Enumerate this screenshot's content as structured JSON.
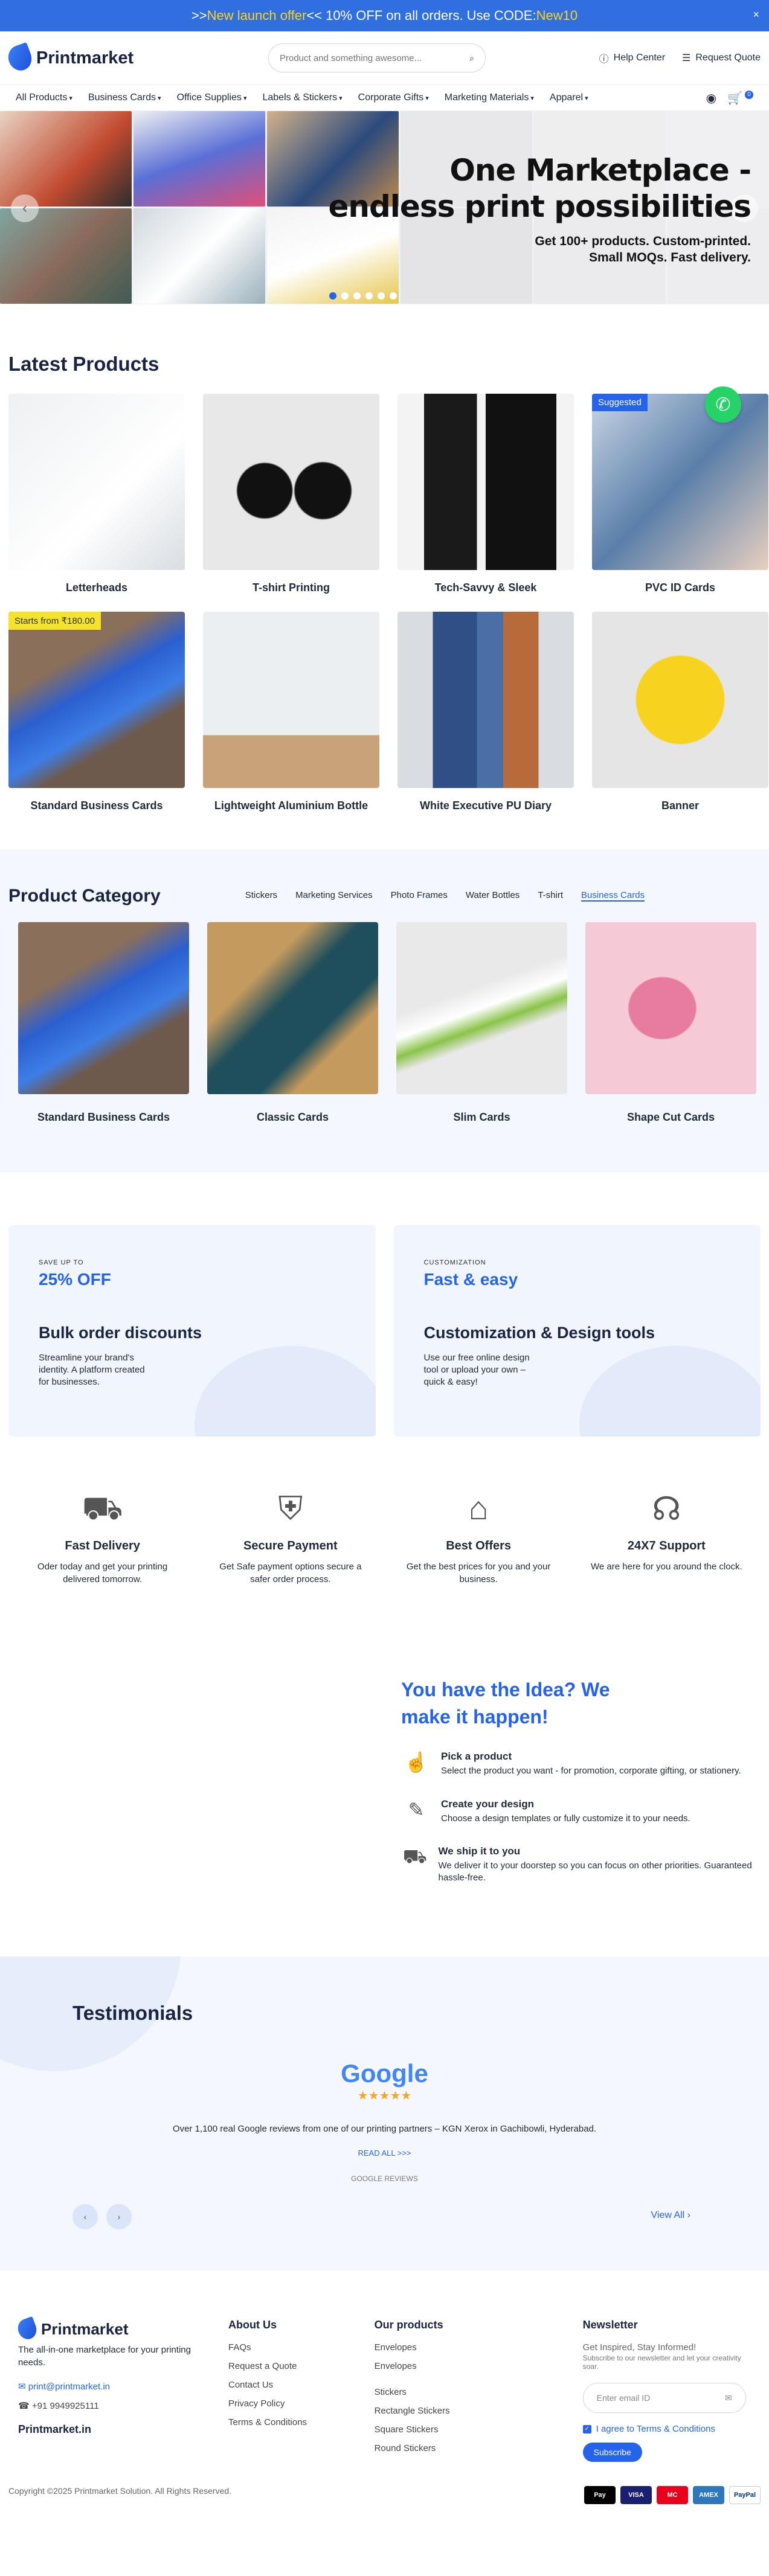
{
  "promo": {
    "pre": ">> ",
    "highlight": "New launch offer",
    "mid": " << 10% OFF on all orders. Use CODE: ",
    "code": "New10",
    "close": "×"
  },
  "header": {
    "brand": "Printmarket",
    "search_placeholder": "Product and something awesome...",
    "help": "Help Center",
    "quote": "Request Quote"
  },
  "nav": {
    "items": [
      "All Products",
      "Business Cards",
      "Office Supplies",
      "Labels & Stickers",
      "Corporate Gifts",
      "Marketing Materials",
      "Apparel"
    ],
    "cart_count": "0"
  },
  "hero": {
    "title_line1": "One Marketplace -",
    "title_line2": "endless print possibilities",
    "sub_line1": "Get 100+ products. Custom-printed.",
    "sub_line2": "Small MOQs. Fast delivery."
  },
  "latest": {
    "title": "Latest Products",
    "items": [
      {
        "name": "Letterheads",
        "badge": ""
      },
      {
        "name": "T-shirt Printing",
        "badge": ""
      },
      {
        "name": "Tech-Savvy & Sleek",
        "badge": ""
      },
      {
        "name": "PVC ID Cards",
        "badge": "Suggested"
      },
      {
        "name": "Standard Business Cards",
        "badge": "Starts from ₹180.00"
      },
      {
        "name": "Lightweight Aluminium Bottle",
        "badge": ""
      },
      {
        "name": "White Executive PU Diary",
        "badge": ""
      },
      {
        "name": "Banner",
        "badge": ""
      }
    ]
  },
  "category": {
    "title": "Product Category",
    "tabs": [
      "Stickers",
      "Marketing Services",
      "Photo Frames",
      "Water Bottles",
      "T-shirt",
      "Business Cards"
    ],
    "active_tab": "Business Cards",
    "cards": [
      "Standard Business Cards",
      "Classic Cards",
      "Slim Cards",
      "Shape Cut Cards"
    ]
  },
  "promos": [
    {
      "small": "SAVE UP TO",
      "big": "25% OFF",
      "title": "Bulk order discounts",
      "desc": "Streamline your brand's identity. A platform created for businesses."
    },
    {
      "small": "CUSTOMIZATION",
      "big": "Fast & easy",
      "title": "Customization & Design tools",
      "desc": "Use our free online design tool or upload your own – quick & easy!"
    }
  ],
  "features": [
    {
      "title": "Fast Delivery",
      "desc": "Oder today and get your printing delivered tomorrow."
    },
    {
      "title": "Secure Payment",
      "desc": "Get Safe payment options secure a safer order process."
    },
    {
      "title": "Best Offers",
      "desc": "Get the best prices for you and your business."
    },
    {
      "title": "24X7 Support",
      "desc": "We are here for you around the clock."
    }
  ],
  "idea": {
    "title_line1": "You have the Idea? We",
    "title_line2": "make it happen!",
    "steps": [
      {
        "title": "Pick a product",
        "desc": "Select the product you want - for promotion, corporate gifting, or stationery."
      },
      {
        "title": "Create your design",
        "desc": "Choose a design templates or fully customize it to your needs."
      },
      {
        "title": "We ship it to you",
        "desc": "We deliver it to your doorstep so you can focus on other priorities. Guaranteed hassle-free."
      }
    ]
  },
  "testimonials": {
    "title": "Testimonials",
    "google": "Google",
    "stars": "★★★★★",
    "text": "Over 1,100 real Google reviews from one of our printing partners – KGN Xerox in Gachibowli, Hyderabad.",
    "read_all": "READ ALL >>>",
    "label": "GOOGLE REVIEWS",
    "view_all": "View All"
  },
  "footer": {
    "brand": "Printmarket",
    "tagline": "The all-in-one marketplace for your printing needs.",
    "email": "print@printmarket.in",
    "phone": "+91 9949925111",
    "domain": "Printmarket.in",
    "about_title": "About Us",
    "about": [
      "FAQs",
      "Request a Quote",
      "Contact Us",
      "Privacy Policy",
      "Terms & Conditions"
    ],
    "products_title": "Our products",
    "products": [
      "Envelopes",
      "Envelopes",
      "Stickers",
      "Rectangle Stickers",
      "Square Stickers",
      "Round Stickers"
    ],
    "news_title": "Newsletter",
    "news_sub": "Get Inspired, Stay Informed!",
    "news_desc": "Subscribe to our newsletter and let your creativity soar.",
    "email_placeholder": "Enter email ID",
    "agree": "I agree to Terms & Conditions",
    "subscribe": "Subscribe"
  },
  "copyright": "Copyright ©2025 Printmarket Solution. All Rights Reserved.",
  "payments": [
    "Pay",
    "VISA",
    "MC",
    "AMEX",
    "PayPal"
  ]
}
